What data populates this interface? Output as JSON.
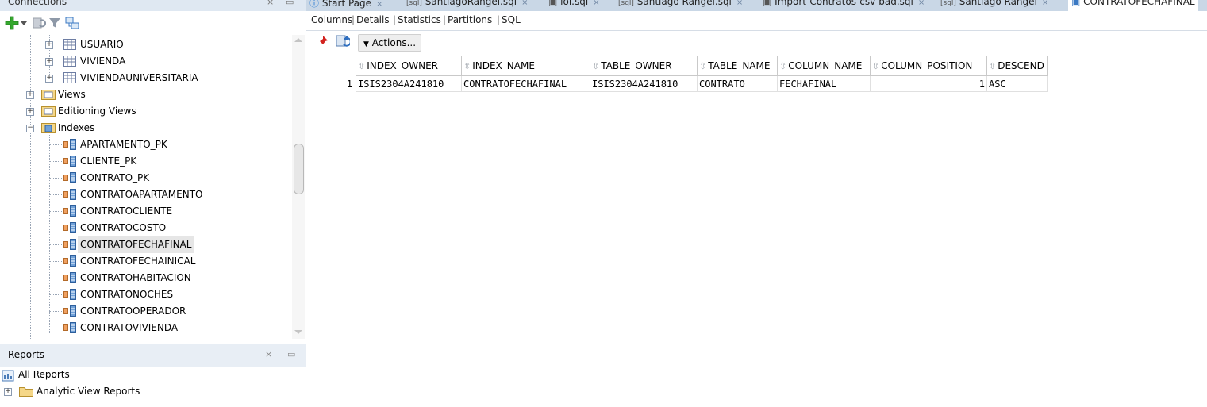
{
  "connections_panel": {
    "title": "Connections",
    "tree": [
      {
        "label": "USUARIO"
      },
      {
        "label": "VIVIENDA"
      },
      {
        "label": "VIVIENDAUNIVERSITARIA"
      },
      {
        "label": "Views"
      },
      {
        "label": "Editioning Views"
      },
      {
        "label": "Indexes"
      },
      {
        "label": "APARTAMENTO_PK"
      },
      {
        "label": "CLIENTE_PK"
      },
      {
        "label": "CONTRATO_PK"
      },
      {
        "label": "CONTRATOAPARTAMENTO"
      },
      {
        "label": "CONTRATOCLIENTE"
      },
      {
        "label": "CONTRATOCOSTO"
      },
      {
        "label": "CONTRATOFECHAFINAL"
      },
      {
        "label": "CONTRATOFECHAINICAL"
      },
      {
        "label": "CONTRATOHABITACION"
      },
      {
        "label": "CONTRATONOCHES"
      },
      {
        "label": "CONTRATOOPERADOR"
      },
      {
        "label": "CONTRATOVIVIENDA"
      }
    ]
  },
  "reports_panel": {
    "title": "Reports",
    "items": [
      {
        "label": "All Reports"
      },
      {
        "label": "Analytic View Reports"
      }
    ]
  },
  "doc_tabs": [
    {
      "label": "Start Page"
    },
    {
      "label": "SantiagoRangel.sql"
    },
    {
      "label": "lol.sql"
    },
    {
      "label": "Santiago Rangel.sql"
    },
    {
      "label": "Import-Contratos-csv-bad.sql"
    },
    {
      "label": "Santiago Rangel"
    },
    {
      "label": "CONTRATOFECHAFINAL"
    }
  ],
  "sub_tabs": [
    "Columns",
    "Details",
    "Statistics",
    "Partitions",
    "SQL"
  ],
  "toolbar": {
    "actions_label": "Actions..."
  },
  "grid": {
    "columns": [
      "INDEX_OWNER",
      "INDEX_NAME",
      "TABLE_OWNER",
      "TABLE_NAME",
      "COLUMN_NAME",
      "COLUMN_POSITION",
      "DESCEND"
    ],
    "rows": [
      {
        "num": "1",
        "cells": [
          "ISIS2304A241810",
          "CONTRATOFECHAFINAL",
          "ISIS2304A241810",
          "CONTRATO",
          "FECHAFINAL",
          "1",
          "ASC"
        ]
      }
    ]
  },
  "colors": {
    "panel_header": "#dfe8f2",
    "tab_strip": "#c9d7e6",
    "selection": "#e6e6e6",
    "add_green": "#35a82e"
  }
}
